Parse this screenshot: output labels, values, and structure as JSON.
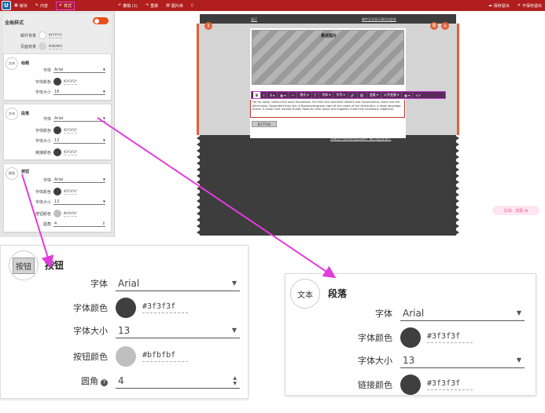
{
  "topbar": {
    "logo": "U",
    "nav": [
      {
        "label": "板块",
        "icon": "blocks-icon",
        "glyph": "▣"
      },
      {
        "label": "内容",
        "icon": "pen-icon",
        "glyph": "✎"
      },
      {
        "label": "样式",
        "icon": "brush-icon",
        "glyph": "✐"
      }
    ],
    "actions": [
      {
        "label": "撤销 (1)",
        "icon": "undo-icon",
        "glyph": "↶"
      },
      {
        "label": "重做",
        "icon": "redo-icon",
        "glyph": "↷"
      },
      {
        "label": "图片库",
        "icon": "image-icon",
        "glyph": "▨"
      },
      {
        "label": "",
        "icon": "mobile-icon",
        "glyph": "▯"
      }
    ],
    "right": [
      {
        "label": "保存退出",
        "icon": "cloud-icon",
        "glyph": "☁"
      },
      {
        "label": "不保存退出",
        "icon": "close-icon",
        "glyph": "✕"
      }
    ]
  },
  "global": {
    "title": "全局样式",
    "rows": [
      {
        "label": "邮件背景",
        "hex": "#ffffff",
        "color": "#ffffff"
      },
      {
        "label": "页面背景",
        "hex": "#d4d4d4",
        "color": "#d4d4d4"
      }
    ]
  },
  "cards": {
    "heading": {
      "badge": "文本",
      "title": "标题",
      "font_label": "字体",
      "font": "Arial",
      "color_label": "字体颜色",
      "color_hex": "#3f3f3f",
      "color": "#3f3f3f",
      "size_label": "字体大小",
      "size": "18"
    },
    "paragraph": {
      "badge": "文本",
      "title": "段落",
      "font_label": "字体",
      "font": "Arial",
      "color_label": "字体颜色",
      "color_hex": "#3f3f3f",
      "color": "#3f3f3f",
      "size_label": "字体大小",
      "size": "13",
      "link_label": "链接颜色",
      "link_hex": "#3f3f3f",
      "link_color": "#3f3f3f"
    },
    "button": {
      "badge": "按钮",
      "title": "按钮",
      "font_label": "字体",
      "font": "Arial",
      "color_label": "字体颜色",
      "color_hex": "#3f3f3f",
      "color": "#3f3f3f",
      "size_label": "字体大小",
      "size": "13",
      "btn_color_label": "按钮颜色",
      "btn_hex": "#bfbfbf",
      "btn_color": "#bfbfbf",
      "radius_label": "圆角",
      "radius": "4"
    }
  },
  "canvas": {
    "top_left_link": "退订",
    "top_right_link": "邮件无法显示请点击此处",
    "image_title": "悬挂图片",
    "toolbar": [
      "B",
      "I",
      "A ▾",
      "▦ ▾",
      "—",
      "格式 ▾",
      "T",
      "字体 ▾",
      "字号 ▾",
      "🔗",
      "⛓",
      "变量 ▾",
      "公共变量 ▾",
      "▦ ▾",
      "<>"
    ],
    "body_text": "Far far away, behind the word mountains, far from the countries Vokalia and Consonantia, there live the blind texts. Separated they live in Bookmarksgrove right at the coast of the Semantics, a large language ocean. A small river named Duden flows by their place and supplies it with the necessary regelialia.",
    "button_label": "BUTTON",
    "bottom_link": "如果您不想再收到此类邮件 请点击此处退订",
    "sticker": "加油 · 鼓励 ✿"
  },
  "colors": {
    "topbar": "#b01e1e",
    "accent": "#e0603a",
    "highlight": "#e23bdc"
  }
}
